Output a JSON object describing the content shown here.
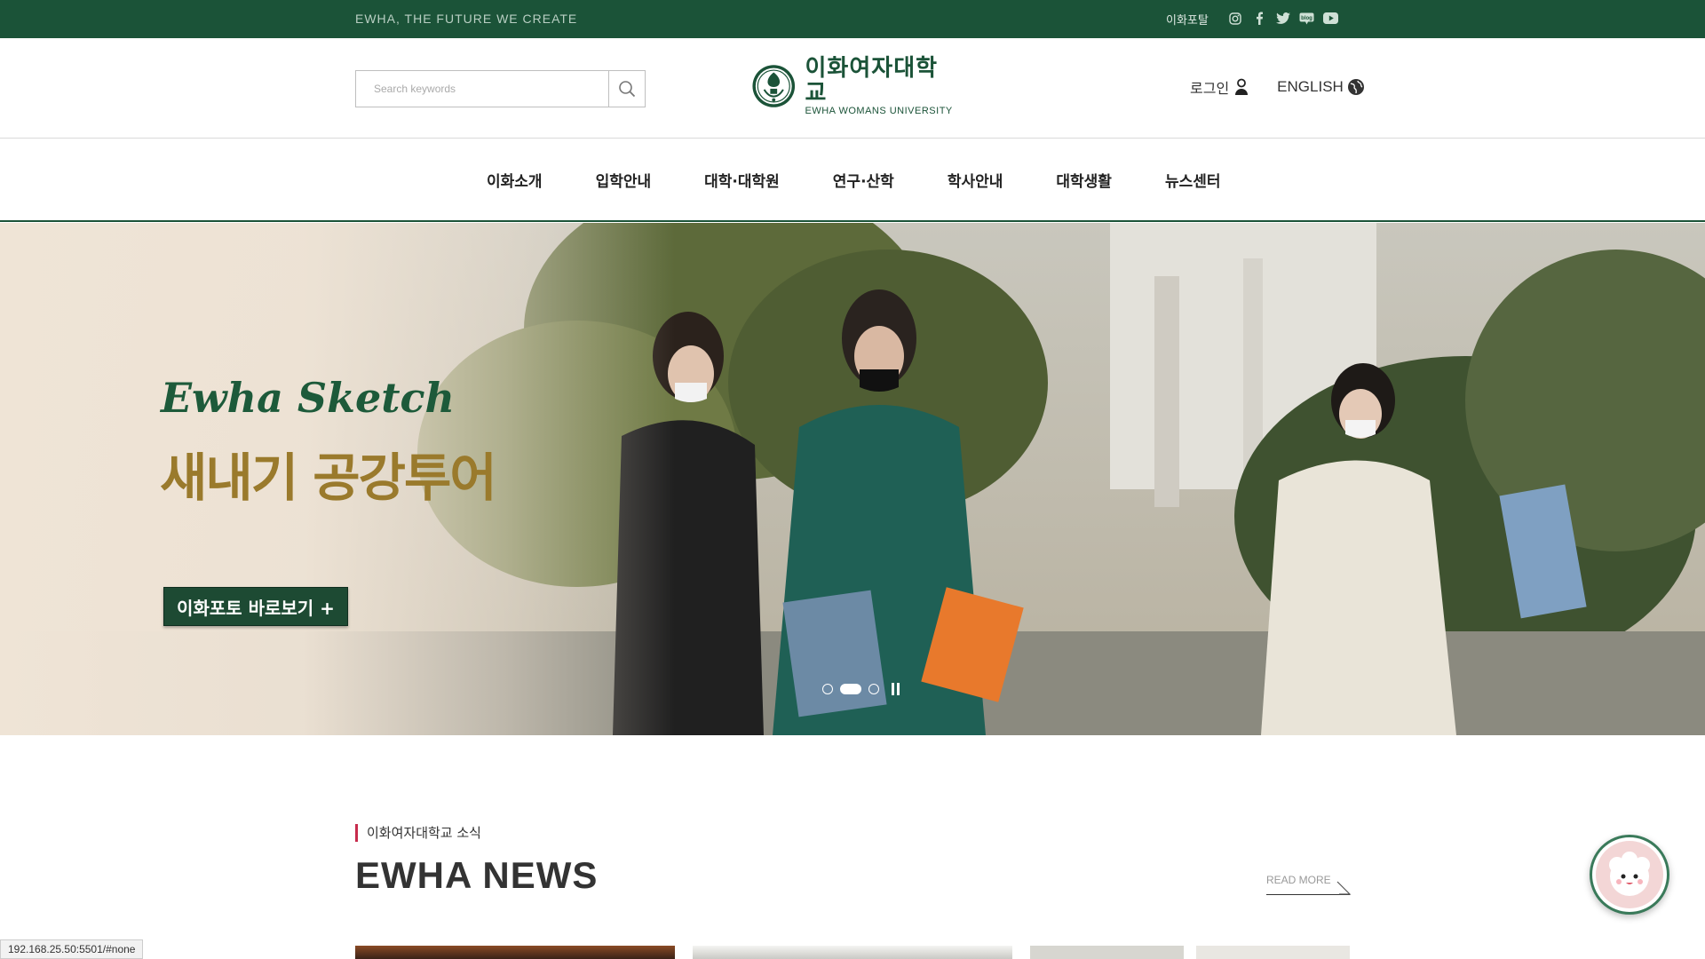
{
  "topbar": {
    "slogan": "EWHA, THE FUTURE WE CREATE",
    "portal_link": "이화포탈",
    "social_icons": [
      "instagram-icon",
      "facebook-icon",
      "twitter-icon",
      "blog-icon",
      "youtube-icon"
    ]
  },
  "header": {
    "search": {
      "placeholder": "Search keywords",
      "value": ""
    },
    "logo": {
      "kr": "이화여자대학교",
      "en": "EWHA WOMANS UNIVERSITY"
    },
    "login_label": "로그인",
    "english_label": "ENGLISH"
  },
  "nav": {
    "items": [
      "이화소개",
      "입학안내",
      "대학·대학원",
      "연구·산학",
      "학사안내",
      "대학생활",
      "뉴스센터"
    ]
  },
  "hero": {
    "script_title": "Ewha Sketch",
    "headline": "새내기 공강투어",
    "cta_label": "이화포토 바로보기 +",
    "slide_count": 3,
    "active_slide": 2
  },
  "news": {
    "subtitle": "이화여자대학교 소식",
    "title": "EWHA NEWS",
    "read_more": "READ MORE"
  },
  "status_url": "192.168.25.50:5501/#none",
  "colors": {
    "brand_green": "#1b5338",
    "accent_red": "#c72b4c",
    "gold": "#9a7a2c"
  }
}
